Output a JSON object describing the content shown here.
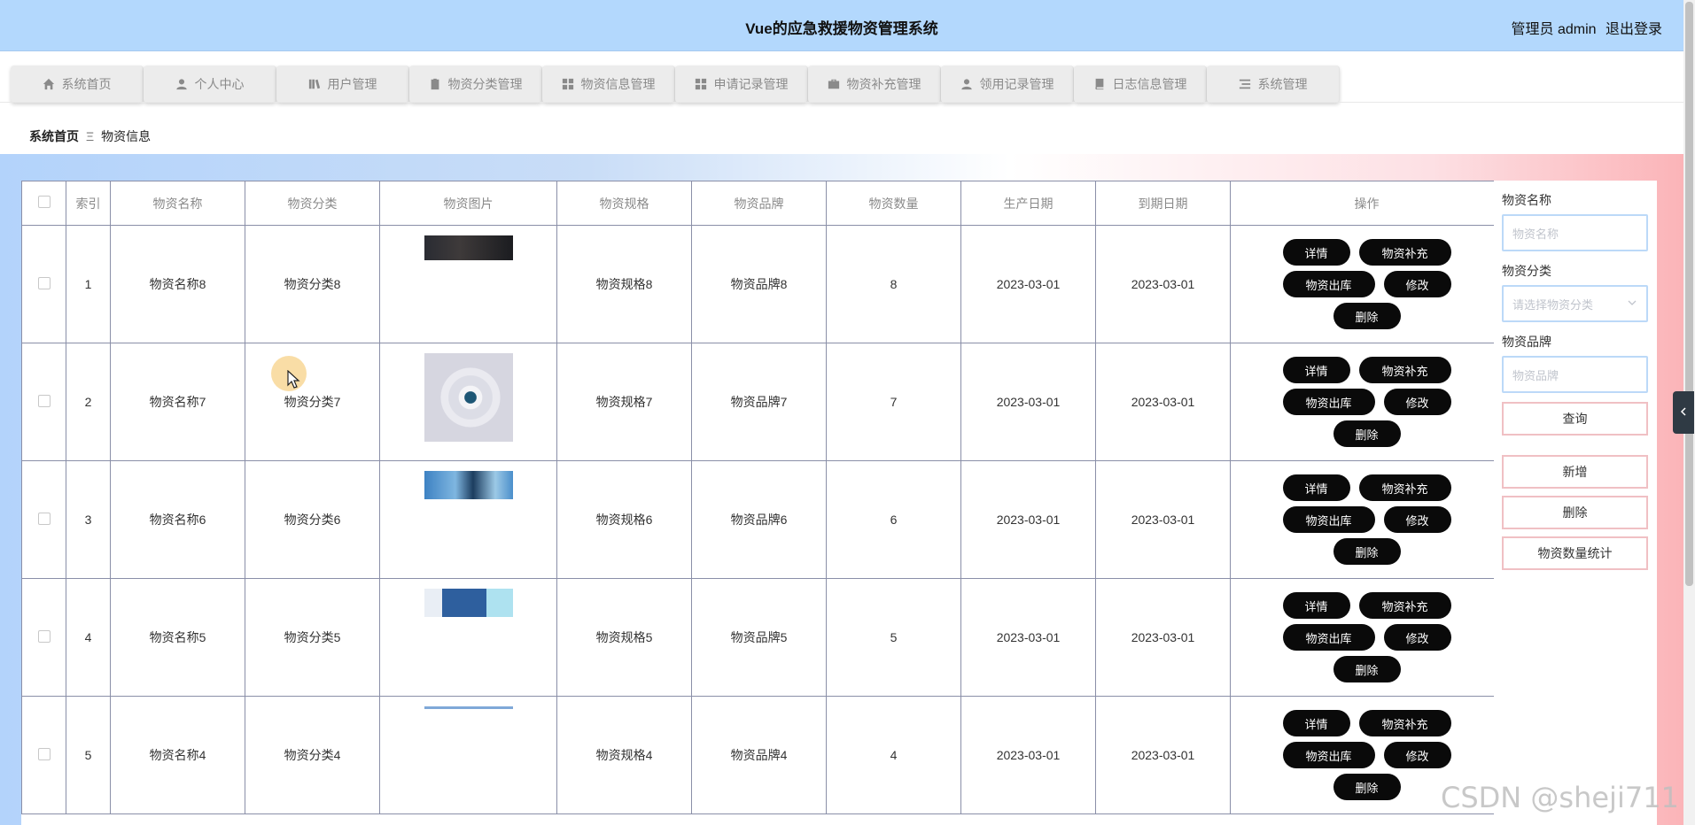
{
  "header": {
    "title": "Vue的应急救援物资管理系统",
    "user_label": "管理员 admin",
    "logout_label": "退出登录"
  },
  "nav": [
    {
      "label": "系统首页",
      "icon": "home-icon"
    },
    {
      "label": "个人中心",
      "icon": "user-icon"
    },
    {
      "label": "用户管理",
      "icon": "books-icon"
    },
    {
      "label": "物资分类管理",
      "icon": "clipboard-icon"
    },
    {
      "label": "物资信息管理",
      "icon": "grid-icon"
    },
    {
      "label": "申请记录管理",
      "icon": "grid-icon"
    },
    {
      "label": "物资补充管理",
      "icon": "briefcase-icon"
    },
    {
      "label": "领用记录管理",
      "icon": "user-icon"
    },
    {
      "label": "日志信息管理",
      "icon": "book-icon"
    },
    {
      "label": "系统管理",
      "icon": "list-icon"
    }
  ],
  "breadcrumb": {
    "home": "系统首页",
    "separator": "Ξ",
    "current": "物资信息"
  },
  "table": {
    "headers": [
      "索引",
      "物资名称",
      "物资分类",
      "物资图片",
      "物资规格",
      "物资品牌",
      "物资数量",
      "生产日期",
      "到期日期",
      "操作"
    ],
    "rows": [
      {
        "index": "1",
        "name": "物资名称8",
        "category": "物资分类8",
        "spec": "物资规格8",
        "brand": "物资品牌8",
        "qty": "8",
        "made": "2023-03-01",
        "expire": "2023-03-01"
      },
      {
        "index": "2",
        "name": "物资名称7",
        "category": "物资分类7",
        "spec": "物资规格7",
        "brand": "物资品牌7",
        "qty": "7",
        "made": "2023-03-01",
        "expire": "2023-03-01"
      },
      {
        "index": "3",
        "name": "物资名称6",
        "category": "物资分类6",
        "spec": "物资规格6",
        "brand": "物资品牌6",
        "qty": "6",
        "made": "2023-03-01",
        "expire": "2023-03-01"
      },
      {
        "index": "4",
        "name": "物资名称5",
        "category": "物资分类5",
        "spec": "物资规格5",
        "brand": "物资品牌5",
        "qty": "5",
        "made": "2023-03-01",
        "expire": "2023-03-01"
      },
      {
        "index": "5",
        "name": "物资名称4",
        "category": "物资分类4",
        "spec": "物资规格4",
        "brand": "物资品牌4",
        "qty": "4",
        "made": "2023-03-01",
        "expire": "2023-03-01"
      }
    ],
    "actions": {
      "detail": "详情",
      "replenish": "物资补充",
      "outbound": "物资出库",
      "edit": "修改",
      "delete": "删除"
    }
  },
  "search": {
    "name_label": "物资名称",
    "name_placeholder": "物资名称",
    "category_label": "物资分类",
    "category_placeholder": "请选择物资分类",
    "brand_label": "物资品牌",
    "brand_placeholder": "物资品牌",
    "query_button": "查询",
    "add_button": "新增",
    "delete_button": "删除",
    "stats_button": "物资数量统计"
  },
  "watermark": "CSDN @sheji711",
  "colors": {
    "header_bg": "#b3d8fd",
    "button_bg": "#0a0a0a",
    "input_border": "#bcd9f8",
    "panel_button_border": "#f0c0c4"
  }
}
